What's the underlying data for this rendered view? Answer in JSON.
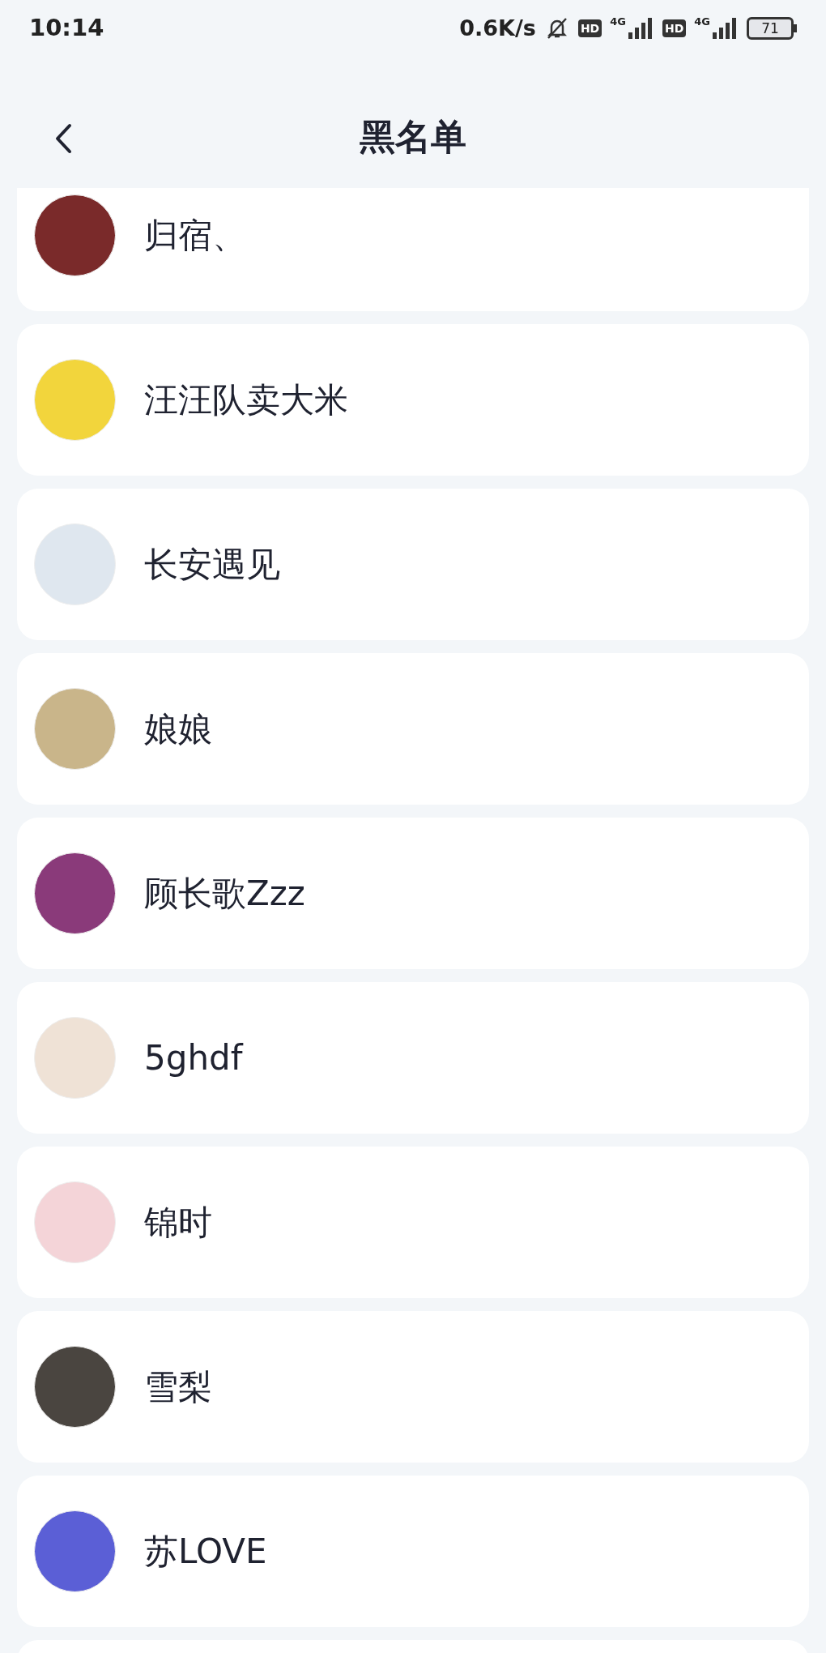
{
  "status_bar": {
    "time": "10:14",
    "network_speed": "0.6K/s",
    "sims": [
      {
        "hd": "HD",
        "network": "4G"
      },
      {
        "hd": "HD",
        "network": "4G"
      }
    ],
    "battery": "71"
  },
  "header": {
    "title": "黑名单"
  },
  "blocked_users": [
    {
      "name": "归宿、"
    },
    {
      "name": "汪汪队卖大米"
    },
    {
      "name": "长安遇见"
    },
    {
      "name": "娘娘"
    },
    {
      "name": "顾长歌Zzz"
    },
    {
      "name": "5ghdf"
    },
    {
      "name": "锦时"
    },
    {
      "name": "雪梨"
    },
    {
      "name": "苏LOVE"
    }
  ]
}
